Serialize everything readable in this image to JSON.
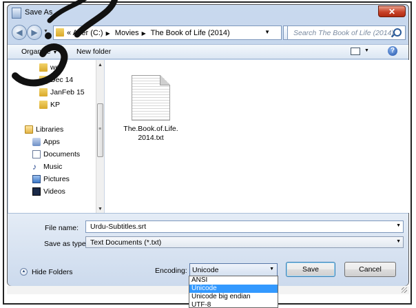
{
  "window": {
    "title": "Save As",
    "close_label": "✕"
  },
  "address": {
    "overflow": "«",
    "crumbs": [
      "Acer (C:)",
      "Movies",
      "The Book of Life (2014)"
    ],
    "search_placeholder": "Search The Book of Life (2014)"
  },
  "toolbar": {
    "organize": "Organize",
    "new_folder": "New folder",
    "help": "?"
  },
  "nav": {
    "items": [
      {
        "label": "web",
        "icon": "folder-icon"
      },
      {
        "label": "Dec 14",
        "icon": "folder-icon"
      },
      {
        "label": "JanFeb 15",
        "icon": "folder-icon"
      },
      {
        "label": "KP",
        "icon": "folder-icon"
      },
      {
        "label": "Libraries",
        "icon": "libraries-icon"
      },
      {
        "label": "Apps",
        "icon": "apps-icon"
      },
      {
        "label": "Documents",
        "icon": "documents-icon"
      },
      {
        "label": "Music",
        "icon": "music-icon"
      },
      {
        "label": "Pictures",
        "icon": "pictures-icon"
      },
      {
        "label": "Videos",
        "icon": "videos-icon"
      }
    ]
  },
  "files": [
    {
      "name": "The.Book.of.Life.\n2014.txt",
      "icon": "text-file-icon"
    }
  ],
  "form": {
    "file_name_label": "File name:",
    "file_name_value": "Urdu-Subtitles.srt",
    "save_type_label": "Save as type:",
    "save_type_value": "Text Documents (*.txt)",
    "hide_folders": "Hide Folders",
    "encoding_label": "Encoding:",
    "encoding_value": "Unicode",
    "save_button": "Save",
    "cancel_button": "Cancel"
  },
  "encoding_options": [
    {
      "label": "ANSI",
      "selected": false
    },
    {
      "label": "Unicode",
      "selected": true
    },
    {
      "label": "Unicode big endian",
      "selected": false
    },
    {
      "label": "UTF-8",
      "selected": false
    }
  ],
  "colors": {
    "selection": "#3399ff",
    "window_frame": "#b3c8e4",
    "close_button": "#c8432a"
  }
}
